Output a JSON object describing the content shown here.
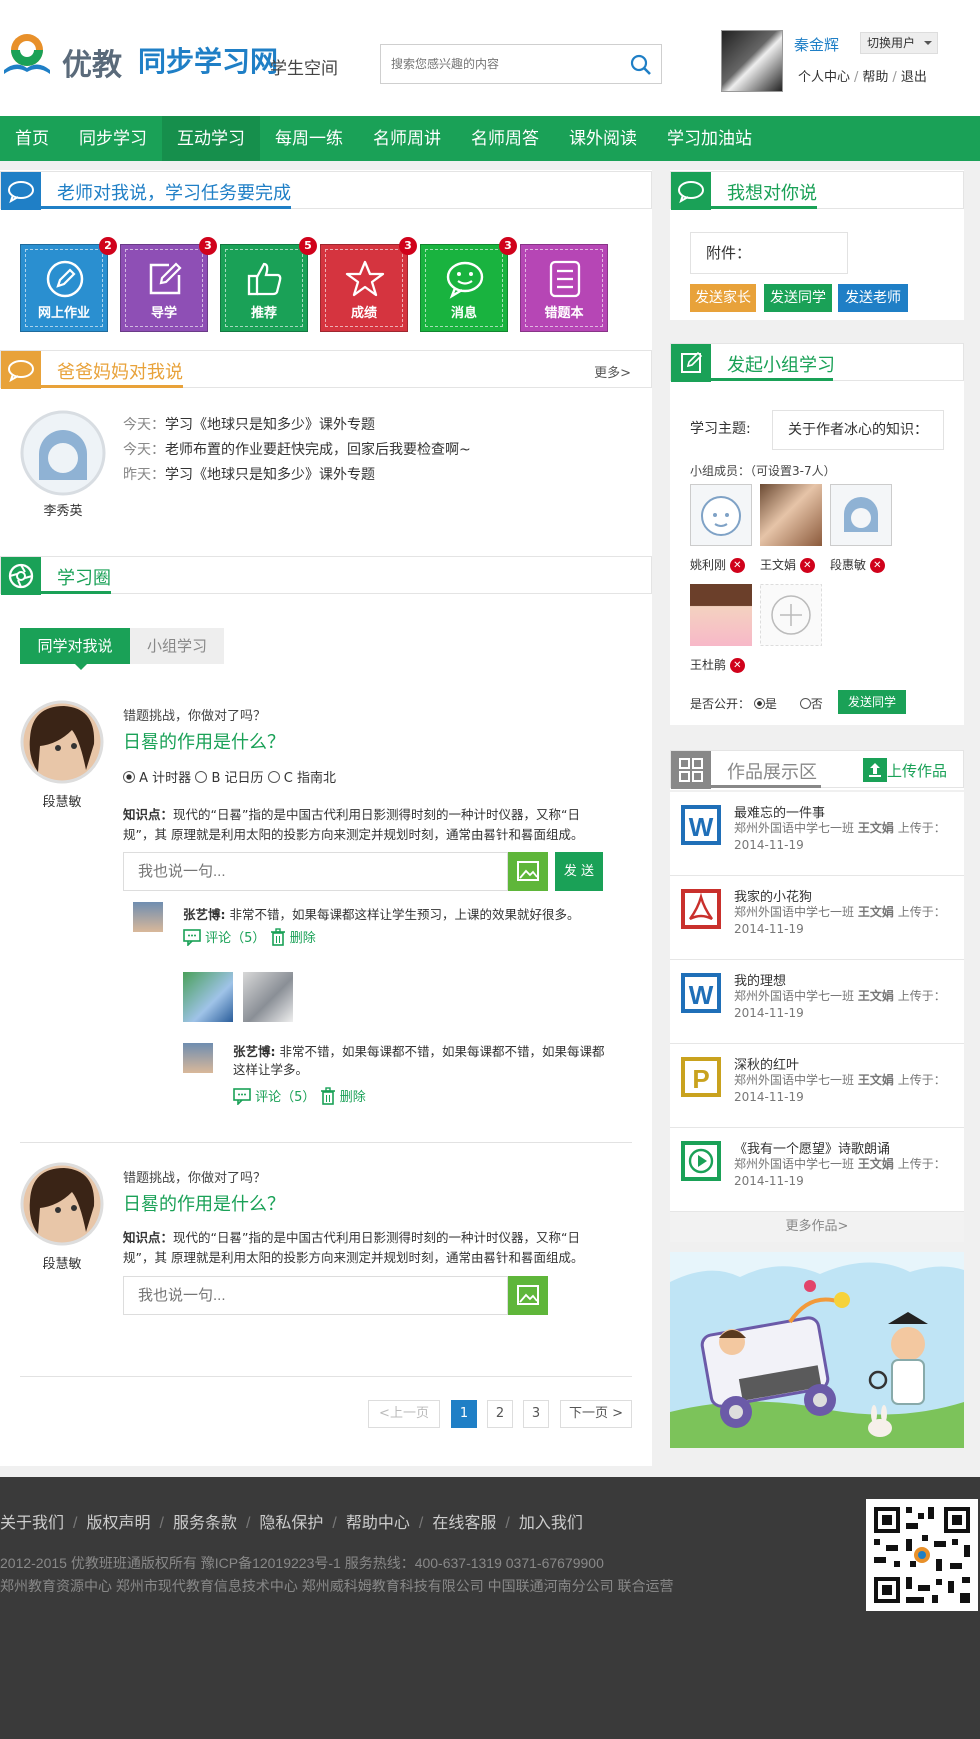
{
  "header": {
    "logo_text_1": "优教",
    "logo_text_2": "同步学习网",
    "subtitle": "学生空间",
    "search_placeholder": "搜索您感兴趣的内容",
    "user_name": "秦金辉",
    "switch_label": "切换用户",
    "links": [
      "个人中心",
      "帮助",
      "退出"
    ]
  },
  "nav": {
    "items": [
      "首页",
      "同步学习",
      "互动学习",
      "每周一练",
      "名师周讲",
      "名师周答",
      "课外阅读",
      "学习加油站"
    ],
    "active_index": 2
  },
  "teacher_section": {
    "title": "老师对我说，学习任务要完成",
    "tiles": [
      {
        "label": "网上作业",
        "badge": "2",
        "color": "#2a8fd0",
        "icon": "pencil-circle-icon"
      },
      {
        "label": "导学",
        "badge": "3",
        "color": "#8e4fb5",
        "icon": "edit-square-icon"
      },
      {
        "label": "推荐",
        "badge": "5",
        "color": "#1aa157",
        "icon": "thumbs-up-icon"
      },
      {
        "label": "成绩",
        "badge": "3",
        "color": "#d5343f",
        "icon": "star-icon"
      },
      {
        "label": "消息",
        "badge": "3",
        "color": "#19b33f",
        "icon": "chat-bubble-icon"
      },
      {
        "label": "错题本",
        "badge": "",
        "color": "#b646b5",
        "icon": "list-doc-icon"
      }
    ]
  },
  "parents_section": {
    "title": "爸爸妈妈对我说",
    "more": "更多>",
    "person": "李秀英",
    "messages": [
      {
        "day": "今天：",
        "text": "学习《地球只是知多少》课外专题"
      },
      {
        "day": "今天：",
        "text": "老师布置的作业要赶快完成，回家后我要检查啊~"
      },
      {
        "day": "昨天：",
        "text": "学习《地球只是知多少》课外专题"
      }
    ]
  },
  "circle_section": {
    "title": "学习圈",
    "tabs": [
      "同学对我说",
      "小组学习"
    ],
    "posts": [
      {
        "author": "段慧敏",
        "intro": "错题挑战，你做对了吗？",
        "question": "日晷的作用是什么？",
        "options": [
          "A 计时器",
          "B 记日历",
          "C 指南北"
        ],
        "knowledge_label": "知识点：",
        "knowledge_text": "现代的“日晷”指的是中国古代利用日影测得时刻的一种计时仪器，又称“日规”，其 原理就是利用太阳的投影方向来测定并规划时刻，通常由晷针和晷面组成。",
        "input_placeholder": "我也说一句...",
        "send_label": "发 送",
        "comments": [
          {
            "name": "张艺博:",
            "text": "非常不错，如果每课都这样让学生预习，上课的效果就好很多。",
            "reply": "评论（5）",
            "delete": "删除"
          },
          {
            "name": "张艺博:",
            "text": "非常不错，如果每课都不错，如果每课都不错，如果每课都这样让学多。",
            "reply": "评论（5）",
            "delete": "删除"
          }
        ]
      },
      {
        "author": "段慧敏",
        "intro": "错题挑战，你做对了吗？",
        "question": "日晷的作用是什么？",
        "knowledge_label": "知识点：",
        "knowledge_text": "现代的“日晷”指的是中国古代利用日影测得时刻的一种计时仪器，又称“日规”，其 原理就是利用太阳的投影方向来测定并规划时刻，通常由晷针和晷面组成。",
        "input_placeholder": "我也说一句..."
      }
    ],
    "pagination": {
      "prev": "<上一页",
      "pages": [
        "1",
        "2",
        "3"
      ],
      "current": "1",
      "next": "下一页 >"
    }
  },
  "say_section": {
    "title": "我想对你说",
    "attach_label": "附件：",
    "buttons": [
      "发送家长",
      "发送同学",
      "发送老师"
    ]
  },
  "group_section": {
    "title": "发起小组学习",
    "topic_label": "学习主题:",
    "topic_value": "关于作者冰心的知识：",
    "members_label": "小组成员：（可设置3-7人）",
    "members": [
      "姚利刚",
      "王文娟",
      "段惠敏",
      "王杜鹃"
    ],
    "public_label": "是否公开：",
    "public_yes": "是",
    "public_no": "否",
    "send": "发送同学"
  },
  "works_section": {
    "title": "作品展示区",
    "upload": "上传作品",
    "items": [
      {
        "title": "最难忘的一件事",
        "meta_pre": "郑州外国语中学七一班",
        "author": "王文娟",
        "meta_post": "上传于：",
        "date": "2014-11-19",
        "type": "word-doc-icon",
        "color": "#1f6fb8"
      },
      {
        "title": "我家的小花狗",
        "meta_pre": "郑州外国语中学七一班",
        "author": "王文娟",
        "meta_post": "上传于：",
        "date": "2014-11-19",
        "type": "pdf-doc-icon",
        "color": "#c9302c"
      },
      {
        "title": "我的理想",
        "meta_pre": "郑州外国语中学七一班",
        "author": "王文娟",
        "meta_post": "上传于：",
        "date": "2014-11-19",
        "type": "word-doc-icon",
        "color": "#1f6fb8"
      },
      {
        "title": "深秋的红叶",
        "meta_pre": "郑州外国语中学七一班",
        "author": "王文娟",
        "meta_post": "上传于：",
        "date": "2014-11-19",
        "type": "ppt-doc-icon",
        "color": "#c9a21e"
      },
      {
        "title": "《我有一个愿望》诗歌朗诵",
        "meta_pre": "郑州外国语中学七一班",
        "author": "王文娟",
        "meta_post": "上传于：",
        "date": "2014-11-19",
        "type": "video-play-icon",
        "color": "#1aa157"
      }
    ],
    "more": "更多作品>"
  },
  "footer": {
    "links": [
      "关于我们",
      "版权声明",
      "服务条款",
      "隐私保护",
      "帮助中心",
      "在线客服",
      "加入我们"
    ],
    "line1": "2012-2015 优教班班通版权所有  豫ICP备12019223号-1      服务热线：400-637-1319    0371-67679900",
    "line2": "郑州教育资源中心     郑州市现代教育信息技术中心    郑州威科姆教育科技有限公司 中国联通河南分公司  联合运营"
  },
  "colors": {
    "green": "#1aa157",
    "blue": "#1f7fc6",
    "orange": "#e8a23a",
    "gray": "#888888"
  }
}
